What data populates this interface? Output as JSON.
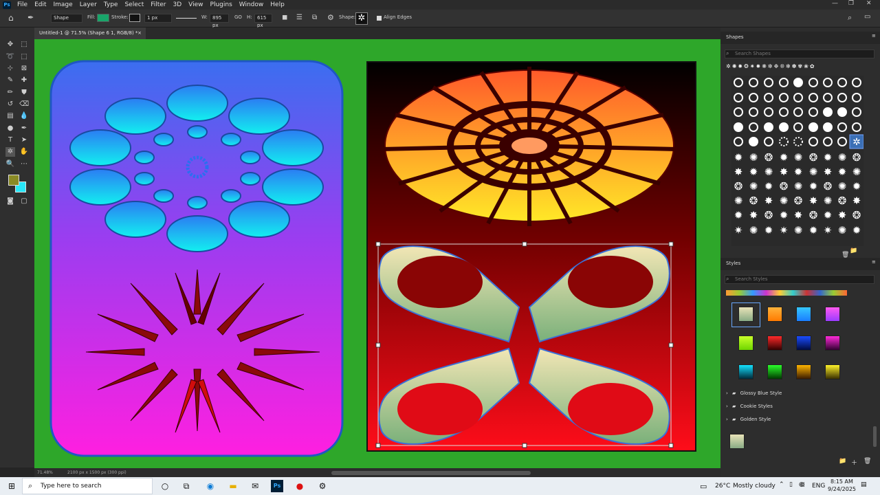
{
  "menubar": {
    "items": [
      "File",
      "Edit",
      "Image",
      "Layer",
      "Type",
      "Select",
      "Filter",
      "3D",
      "View",
      "Plugins",
      "Window",
      "Help"
    ],
    "app_icon": "Ps"
  },
  "options": {
    "tool_mode": "Shape",
    "fill_label": "Fill:",
    "stroke_label": "Stroke:",
    "stroke_width": "1 px",
    "w_label": "W:",
    "w_value": "895 px",
    "link_label": "GO",
    "h_label": "H:",
    "h_value": "615 px",
    "shape_label": "Shape:",
    "align_edges": "Align Edges",
    "fill_color": "#19a56a"
  },
  "document": {
    "tab_title": "Untitled-1 @ 71.5% (Shape 6 1, RGB/8) *",
    "tab_close": "×"
  },
  "status": {
    "zoom": "71.48%",
    "dimensions": "2100 px x 1500 px (300 ppi)"
  },
  "shapes_panel": {
    "title": "Shapes",
    "search_placeholder": "Search Shapes"
  },
  "styles_panel": {
    "title": "Styles",
    "search_placeholder": "Search Styles",
    "groups": [
      "Glossy Blue Style",
      "Cookie Styles",
      "Golden Style"
    ]
  },
  "taskbar": {
    "search_placeholder": "Type here to search",
    "temperature": "26°C",
    "weather": "Mostly cloudy",
    "language": "ENG",
    "time": "8:15 AM",
    "date": "9/24/2025"
  },
  "colors": {
    "canvas_bg": "#2ea72a",
    "foreground": "#8a8a25",
    "background": "#28e6f7"
  }
}
